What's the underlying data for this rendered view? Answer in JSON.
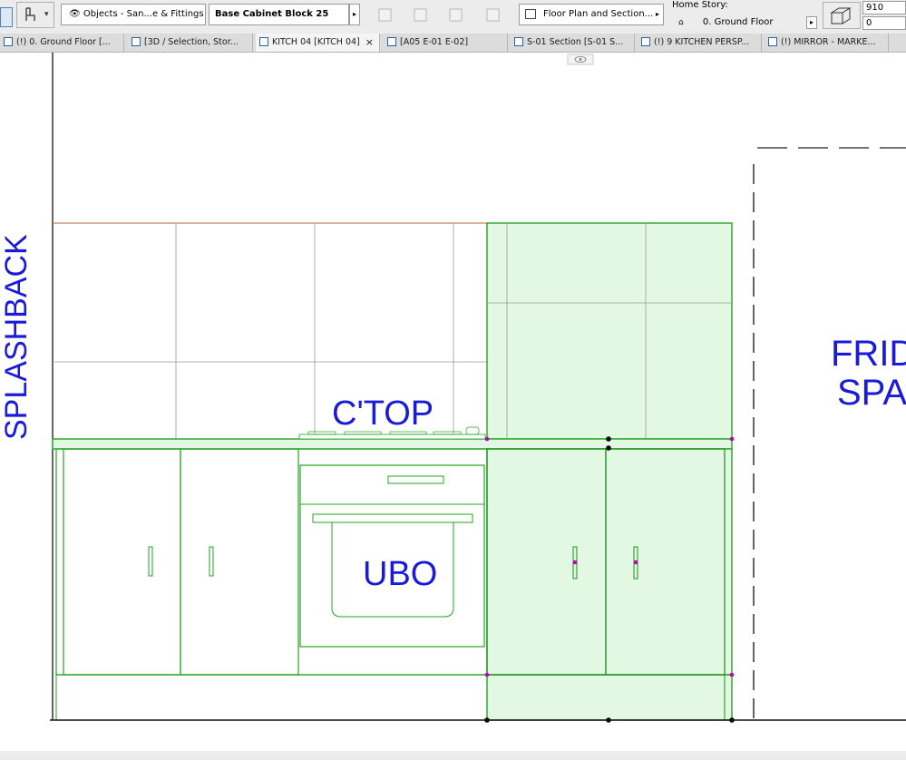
{
  "toolbar": {
    "layer_field": "Objects - San...e & Fittings",
    "element_name": "Base Cabinet Block 25",
    "view_field": "Floor Plan and Section...",
    "home_story_label": "Home Story:",
    "home_story_value": "0. Ground Floor",
    "height_value": "910",
    "offset_value": "0"
  },
  "tabs": [
    {
      "label": "(!) 0. Ground Floor [...",
      "icon": "floor-plan-icon"
    },
    {
      "label": "[3D / Selection, Stor...",
      "icon": "3d-view-icon"
    },
    {
      "label": "KITCH 04 [KITCH 04]",
      "icon": "interior-elevation-icon",
      "active": true,
      "close": "×"
    },
    {
      "label": "[A05 E-01 E-02]",
      "icon": "layout-icon"
    },
    {
      "label": "S-01 Section [S-01 S...",
      "icon": "section-icon"
    },
    {
      "label": "(!) 9 KITCHEN PERSP...",
      "icon": "perspective-icon"
    },
    {
      "label": "(!) MIRROR - MARKE...",
      "icon": "elevation-icon"
    }
  ],
  "drawing": {
    "labels": {
      "splashback": "SPLASHBACK",
      "countertop": "C'TOP",
      "oven": "UBO",
      "fridge_line1": "FRID",
      "fridge_line2": "SPAC"
    }
  },
  "colors": {
    "label_blue": "#1a1adc",
    "selection_green": "#21a621",
    "selection_fill": "#e3f8e3",
    "tile_border": "#b06a3a",
    "hotspot": "#c000c0"
  }
}
